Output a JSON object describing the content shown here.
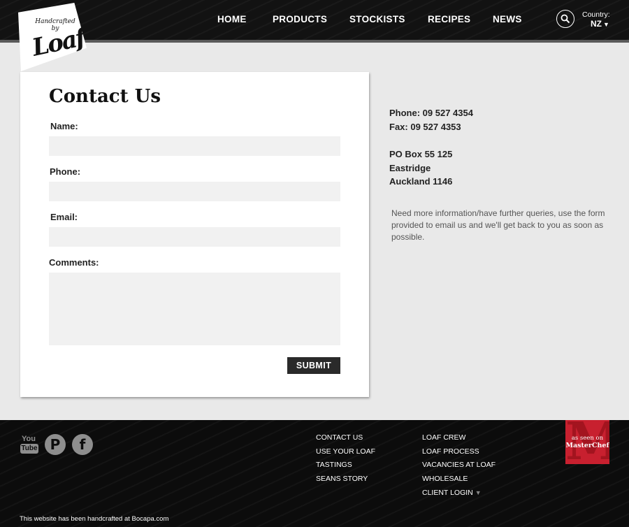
{
  "brand": {
    "logo_small": "Handcrafted by",
    "logo_main": "Loaf"
  },
  "nav": {
    "items": [
      "HOME",
      "PRODUCTS",
      "STOCKISTS",
      "RECIPES",
      "NEWS"
    ]
  },
  "country": {
    "label": "Country:",
    "value": "NZ",
    "caret": "▼"
  },
  "form": {
    "title": "Contact Us",
    "name_label": "Name:",
    "phone_label": "Phone:",
    "email_label": "Email:",
    "comments_label": "Comments:",
    "name_value": "",
    "phone_value": "",
    "email_value": "",
    "comments_value": "",
    "submit_label": "SUBMIT"
  },
  "contact": {
    "phone": "Phone: 09 527 4354",
    "fax": "Fax: 09 527 4353",
    "address": [
      "PO Box 55 125",
      "Eastridge",
      "Auckland 1146"
    ],
    "note": "Need more information/have further queries, use the form provided to email us and we'll get back to you as soon as possible."
  },
  "footer": {
    "social": {
      "youtube_top": "You",
      "youtube_bottom": "Tube",
      "pinterest": "P",
      "facebook": "f"
    },
    "col1": [
      "CONTACT US",
      "USE YOUR LOAF",
      "TASTINGS",
      "SEANS STORY"
    ],
    "col2": [
      "LOAF CREW",
      "LOAF PROCESS",
      "VACANCIES AT LOAF",
      "WHOLESALE",
      "CLIENT LOGIN"
    ],
    "client_login_caret": "▼",
    "badge": {
      "line1": "as seen on",
      "line2": "MasterChef",
      "letter": "M"
    },
    "credit": "This website has been handcrafted at Bocapa.com"
  },
  "colors": {
    "header_bg": "#121212",
    "footer_bg": "#0c0c0c",
    "page_bg": "#e9e9e9",
    "badge_red": "#c8202f",
    "button_bg": "#2a2a2a"
  }
}
